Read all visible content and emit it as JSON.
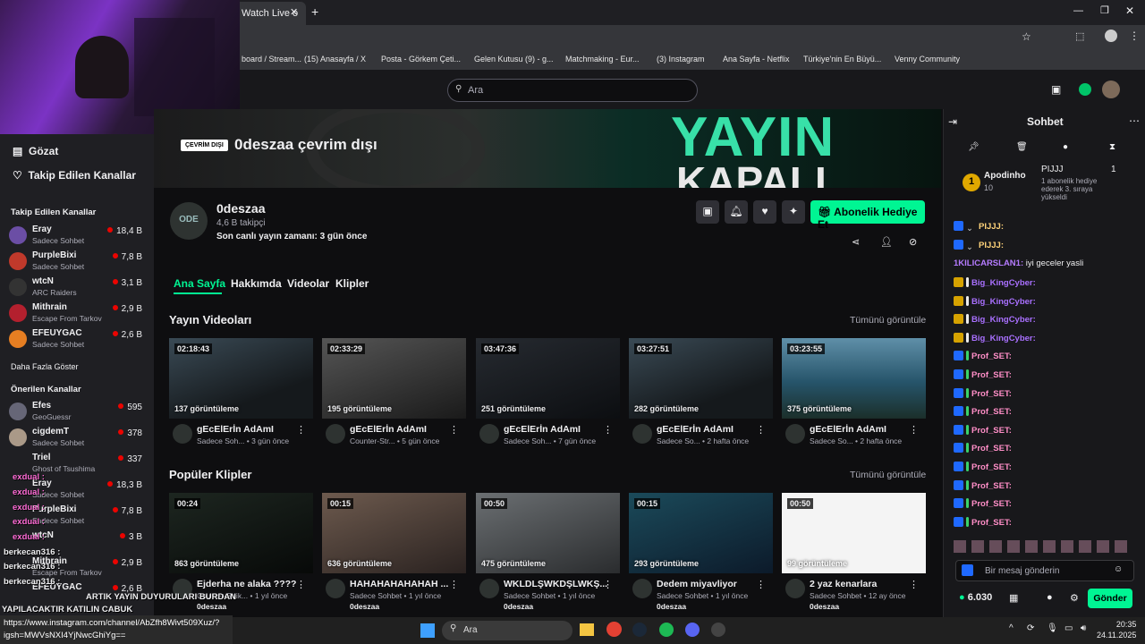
{
  "browser": {
    "tab_title": "Watch Live o",
    "add_tab": "+",
    "bookmarks": [
      "board / Stream...",
      "(15) Anasayfa / X",
      "Posta - Görkem Çeti...",
      "Gelen Kutusu (9) - g...",
      "Matchmaking - Eur...",
      "(3) Instagram",
      "Ana Sayfa - Netflix",
      "Türkiye'nin En Büyü...",
      "Venny Community"
    ]
  },
  "search": {
    "placeholder": "Ara"
  },
  "sidebar": {
    "nav": [
      "Gözat",
      "Takip Edilen Kanallar"
    ],
    "followed_header": "Takip Edilen Kanallar",
    "followed": [
      {
        "name": "Eray",
        "game": "Sadece Sohbet",
        "viewers": "18,4 B"
      },
      {
        "name": "PurpleBixi",
        "game": "Sadece Sohbet",
        "viewers": "7,8 B"
      },
      {
        "name": "wtcN",
        "game": "ARC Raiders",
        "viewers": "3,1 B"
      },
      {
        "name": "Mithrain",
        "game": "Escape From Tarkov",
        "viewers": "2,9 B"
      },
      {
        "name": "EFEUYGAC",
        "game": "Sadece Sohbet",
        "viewers": "2,6 B"
      }
    ],
    "show_more": "Daha Fazla Göster",
    "recommended_header": "Önerilen Kanallar",
    "recommended": [
      {
        "name": "Efes",
        "game": "GeoGuessr",
        "viewers": "595"
      },
      {
        "name": "cigdemT",
        "game": "Sadece Sohbet",
        "viewers": "378"
      },
      {
        "name": "Triel",
        "game": "Ghost of Tsushima",
        "viewers": "337"
      },
      {
        "name": "Eray",
        "game": "Sadece Sohbet",
        "viewers": "18,3 B"
      },
      {
        "name": "PurpleBixi",
        "game": "Sadece Sohbet",
        "viewers": "7,8 B"
      },
      {
        "name": "wtcN",
        "game": "",
        "viewers": "3 B"
      },
      {
        "name": "Mithrain",
        "game": "Escape From Tarkov",
        "viewers": "2,9 B"
      },
      {
        "name": "EFEUYGAC",
        "game": "",
        "viewers": "2,6 B"
      }
    ]
  },
  "banner": {
    "offline_badge": "ÇEVRİM DIŞI",
    "offline_title": "0deszaa çevrim dışı",
    "art_line1": "YAYIN",
    "art_line2": "KAPALI"
  },
  "channel": {
    "avatar_text": "ODE",
    "name": "0deszaa",
    "followers": "4,6 B takipçi",
    "last_live": "Son canlı yayın zamanı: 3 gün önce",
    "gift_button": "Abonelik Hediye Et"
  },
  "tabs": [
    "Ana Sayfa",
    "Hakkımda",
    "Videolar",
    "Klipler"
  ],
  "videos": {
    "title": "Yayın Videoları",
    "see_all": "Tümünü görüntüle",
    "items": [
      {
        "dur": "02:18:43",
        "views": "137 görüntüleme",
        "title": "gEcElErİn AdAmI",
        "meta": "Sadece Soh... • 3 gün önce"
      },
      {
        "dur": "02:33:29",
        "views": "195 görüntüleme",
        "title": "gEcElErİn AdAmI",
        "meta": "Counter-Str... • 5 gün önce"
      },
      {
        "dur": "03:47:36",
        "views": "251 görüntüleme",
        "title": "gEcElErİn AdAmI",
        "meta": "Sadece Soh... • 7 gün önce"
      },
      {
        "dur": "03:27:51",
        "views": "282 görüntüleme",
        "title": "gEcElErİn AdAmI",
        "meta": "Sadece So... • 2 hafta önce"
      },
      {
        "dur": "03:23:55",
        "views": "375 görüntüleme",
        "title": "gEcElErİn AdAmI",
        "meta": "Sadece So... • 2 hafta önce"
      }
    ]
  },
  "clips": {
    "title": "Popüler Klipler",
    "see_all": "Tümünü görüntüle",
    "items": [
      {
        "dur": "00:24",
        "views": "863 görüntüleme",
        "title": "Ejderha ne alaka ????",
        "meta": "Counter-Strik... • 1 yıl önce",
        "channel": "0deszaa"
      },
      {
        "dur": "00:15",
        "views": "636 görüntüleme",
        "title": "HAHAHAHAHAHAH ...",
        "meta": "Sadece Sohbet • 1 yıl önce",
        "channel": "0deszaa"
      },
      {
        "dur": "00:50",
        "views": "475 görüntüleme",
        "title": "WKLDLŞWKDŞLWKŞ...",
        "meta": "Sadece Sohbet • 1 yıl önce",
        "channel": "0deszaa"
      },
      {
        "dur": "00:15",
        "views": "293 görüntüleme",
        "title": "Dedem miyavliyor",
        "meta": "Sadece Sohbet • 1 yıl önce",
        "channel": "0deszaa"
      },
      {
        "dur": "00:50",
        "views": "99 görüntüleme",
        "title": "2 yaz kenarlara",
        "meta": "Sadece Sohbet • 12 ay önce",
        "channel": "0deszaa"
      }
    ]
  },
  "chat": {
    "title": "Sohbet",
    "leader1": {
      "rank": "1",
      "name": "Apodinho",
      "count": "10"
    },
    "leader2": {
      "name": "PIJJJ",
      "rank": "1",
      "note": "1 abonelik hediye ederek 3. sıraya yükseldi"
    },
    "messages": [
      {
        "user": "PIJJJ:",
        "color": "#ffd37a",
        "text": ""
      },
      {
        "user": "PIJJJ:",
        "color": "#ffd37a",
        "text": ""
      },
      {
        "user": "1KILICARSLAN1:",
        "color": "#b57bff",
        "text": " iyi geceler yasli"
      },
      {
        "user": "Big_KingCyber:",
        "color": "#a970ff",
        "text": ""
      },
      {
        "user": "Big_KingCyber:",
        "color": "#a970ff",
        "text": ""
      },
      {
        "user": "Big_KingCyber:",
        "color": "#a970ff",
        "text": ""
      },
      {
        "user": "Big_KingCyber:",
        "color": "#a970ff",
        "text": ""
      },
      {
        "user": "Prof_SET:",
        "color": "#ff8ec7",
        "text": ""
      },
      {
        "user": "Prof_SET:",
        "color": "#ff8ec7",
        "text": ""
      },
      {
        "user": "Prof_SET:",
        "color": "#ff8ec7",
        "text": ""
      },
      {
        "user": "Prof_SET:",
        "color": "#ff8ec7",
        "text": ""
      },
      {
        "user": "Prof_SET:",
        "color": "#ff8ec7",
        "text": ""
      },
      {
        "user": "Prof_SET:",
        "color": "#ff8ec7",
        "text": ""
      },
      {
        "user": "Prof_SET:",
        "color": "#ff8ec7",
        "text": ""
      },
      {
        "user": "Prof_SET:",
        "color": "#ff8ec7",
        "text": ""
      },
      {
        "user": "Prof_SET:",
        "color": "#ff8ec7",
        "text": ""
      },
      {
        "user": "Prof_SET:",
        "color": "#ff8ec7",
        "text": ""
      }
    ],
    "input_placeholder": "Bir mesaj gönderin",
    "points": "6.030",
    "send": "Gönder"
  },
  "overlay": {
    "lines": [
      {
        "t": "exdual :",
        "c": "#ff6bd6"
      },
      {
        "t": "exdual :",
        "c": "#ff6bd6"
      },
      {
        "t": "exdual :",
        "c": "#ff6bd6"
      },
      {
        "t": "exdual :",
        "c": "#ff6bd6"
      },
      {
        "t": "exdual :",
        "c": "#ff6bd6"
      },
      {
        "t": "berkecan316 :",
        "c": "#ffffff"
      },
      {
        "t": "berkecan316 :",
        "c": "#ffffff"
      },
      {
        "t": "berkecan316 :",
        "c": "#ffffff"
      },
      {
        "t": "ARTIK YAYIN DUYURULARI BURDAN",
        "c": "#ffffff"
      },
      {
        "t": "YAPILACAKTIR KATILIN CABUK",
        "c": "#ffffff"
      }
    ],
    "url": "https://www.instagram.com/channel/AbZfh8Wivt509Xuz/?igsh=MWVsNXI4YjNwcGhiYg=="
  },
  "taskbar": {
    "search": "Ara",
    "time": "20:35",
    "date": "24.11.2025"
  },
  "colors": {
    "accent": "#00f593",
    "live": "#eb0400"
  }
}
